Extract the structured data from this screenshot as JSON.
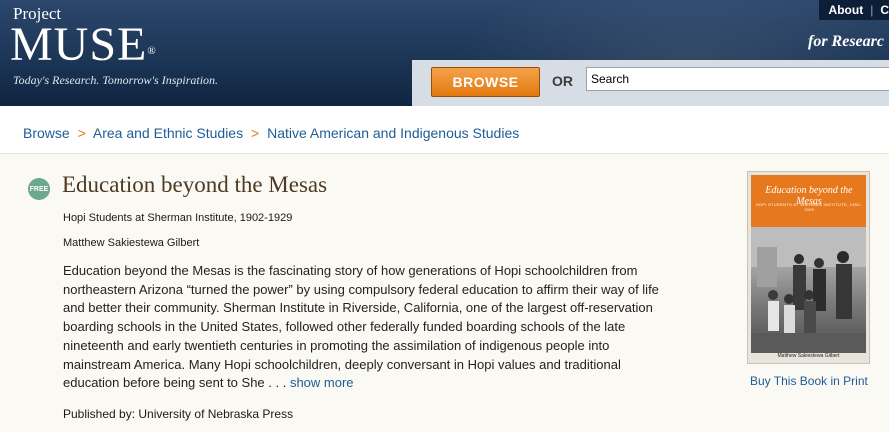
{
  "header": {
    "logo_project": "Project",
    "logo_muse": "MUSE",
    "logo_reg": "®",
    "tagline": "Today's Research. Tomorrow's Inspiration.",
    "top_links": [
      "About",
      "C"
    ],
    "research_text": "for Researc",
    "browse_label": "BROWSE",
    "or_label": "OR",
    "search_value": "Search"
  },
  "breadcrumb": {
    "items": [
      "Browse",
      "Area and Ethnic Studies",
      "Native American and Indigenous Studies"
    ],
    "separator": ">"
  },
  "book": {
    "badge": "FREE",
    "title": "Education beyond the Mesas",
    "subtitle": "Hopi Students at Sherman Institute, 1902-1929",
    "author": "Matthew Sakiestewa Gilbert",
    "description": "Education beyond the Mesas is the fascinating story of how generations of Hopi schoolchildren from northeastern Arizona “turned the power” by using compulsory federal education to affirm their way of life and better their community. Sherman Institute in Riverside, California, one of the largest off-reservation boarding schools in the United States, followed other federally funded boarding schools of the late nineteenth and early twentieth centuries in promoting the assimilation of indigenous people into mainstream America. Many Hopi schoolchildren, deeply conversant in Hopi values and traditional education before being sent to She . . .",
    "show_more": "show more",
    "publisher": "Published by: University of Nebraska Press"
  },
  "cover": {
    "title": "Education beyond the Mesas",
    "subtitle": "HOPI STUDENTS AT SHERMAN INSTITUTE, 1902–1929",
    "author": "Matthew Sakiestewa Gilbert"
  },
  "buy_link": "Buy This Book in Print",
  "colors": {
    "header_navy": "#1d3656",
    "browse_orange": "#e2790f",
    "link_blue": "#1f5c97",
    "title_brown": "#4c3a22",
    "free_green": "#6aa98b"
  },
  "icons": [
    "free-badge-icon"
  ]
}
